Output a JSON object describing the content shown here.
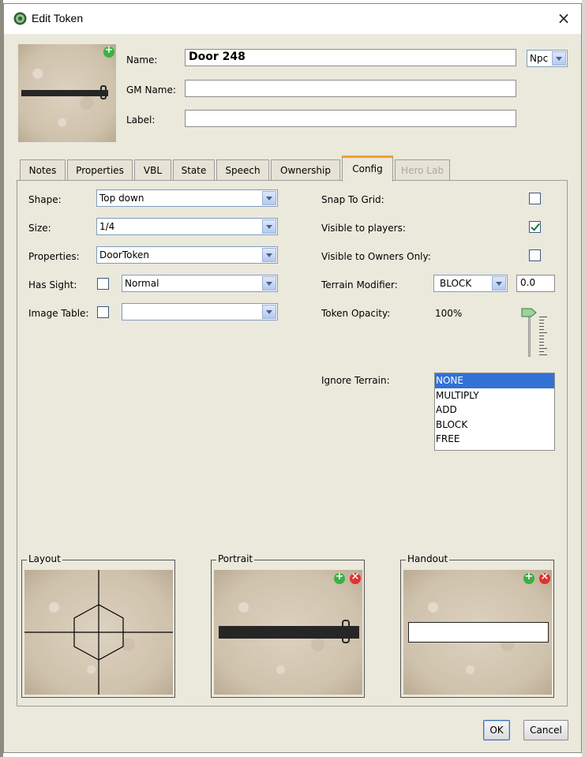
{
  "window": {
    "title": "Edit Token",
    "close": "×"
  },
  "header": {
    "name_label": "Name:",
    "name_value": "Door 248",
    "type_value": "Npc",
    "gm_name_label": "GM Name:",
    "gm_name_value": "",
    "label_label": "Label:",
    "label_value": ""
  },
  "tabs": [
    {
      "label": "Notes"
    },
    {
      "label": "Properties"
    },
    {
      "label": "VBL"
    },
    {
      "label": "State"
    },
    {
      "label": "Speech"
    },
    {
      "label": "Ownership"
    },
    {
      "label": "Config",
      "active": true
    },
    {
      "label": "Hero Lab",
      "disabled": true
    }
  ],
  "config": {
    "shape_label": "Shape:",
    "shape_value": "Top down",
    "size_label": "Size:",
    "size_value": "1/4",
    "properties_label": "Properties:",
    "properties_value": "DoorToken",
    "has_sight_label": "Has Sight:",
    "has_sight_checked": false,
    "sight_value": "Normal",
    "image_table_label": "Image Table:",
    "image_table_checked": false,
    "image_table_value": "",
    "snap_label": "Snap To Grid:",
    "snap_checked": false,
    "visible_label": "Visible to players:",
    "visible_checked": true,
    "owners_label": "Visible to Owners Only:",
    "owners_checked": false,
    "terrain_label": "Terrain Modifier:",
    "terrain_value": "BLOCK",
    "terrain_number": "0.0",
    "opacity_label": "Token Opacity:",
    "opacity_value": "100%",
    "opacity_level": 1.0,
    "ignore_label": "Ignore Terrain:",
    "ignore_options": [
      "NONE",
      "MULTIPLY",
      "ADD",
      "BLOCK",
      "FREE"
    ],
    "ignore_selected": "NONE"
  },
  "groups": {
    "layout": "Layout",
    "portrait": "Portrait",
    "handout": "Handout"
  },
  "buttons": {
    "ok": "OK",
    "cancel": "Cancel"
  },
  "colors": {
    "accent": "#f0a030",
    "selection": "#3471d4",
    "dialog_bg": "#ebe8dc"
  }
}
